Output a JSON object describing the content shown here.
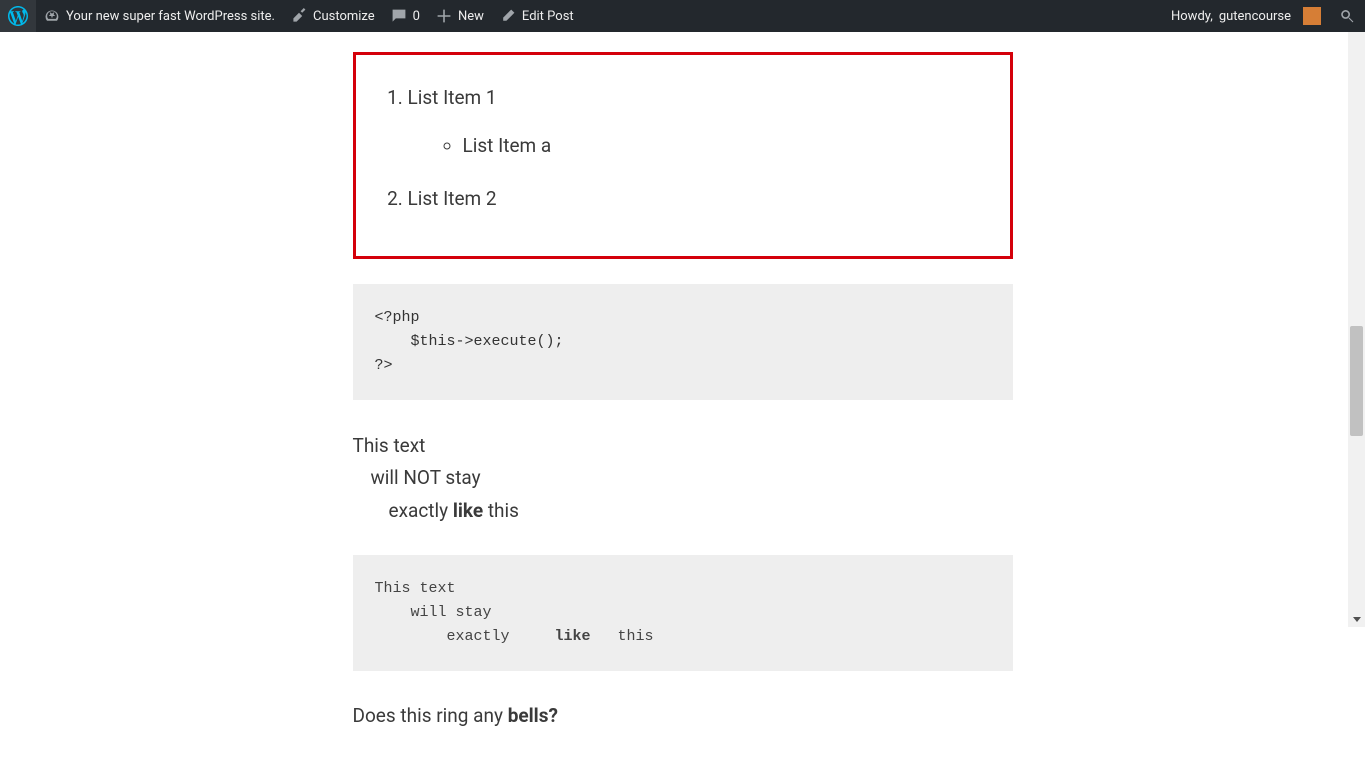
{
  "adminbar": {
    "site_title": "Your new super fast WordPress site.",
    "customize": "Customize",
    "comments_count": "0",
    "new": "New",
    "edit_post": "Edit Post",
    "howdy_prefix": "Howdy, ",
    "username": "gutencourse"
  },
  "list": {
    "item1": "List Item 1",
    "item_a": "List Item a",
    "item2": "List Item 2"
  },
  "code_block": "<?php\n    $this->execute();\n?>",
  "paragraph": {
    "line1": "This text",
    "line2": "will NOT stay",
    "line3_a": "exactly     ",
    "line3_bold": "like",
    "line3_b": " this"
  },
  "pre_block": {
    "line1": "This text",
    "line2": "    will stay",
    "line3_a": "        exactly     ",
    "line3_bold": "like",
    "line3_b": "   this"
  },
  "footer": {
    "text_a": "Does this ring any ",
    "bold": "bells?"
  }
}
